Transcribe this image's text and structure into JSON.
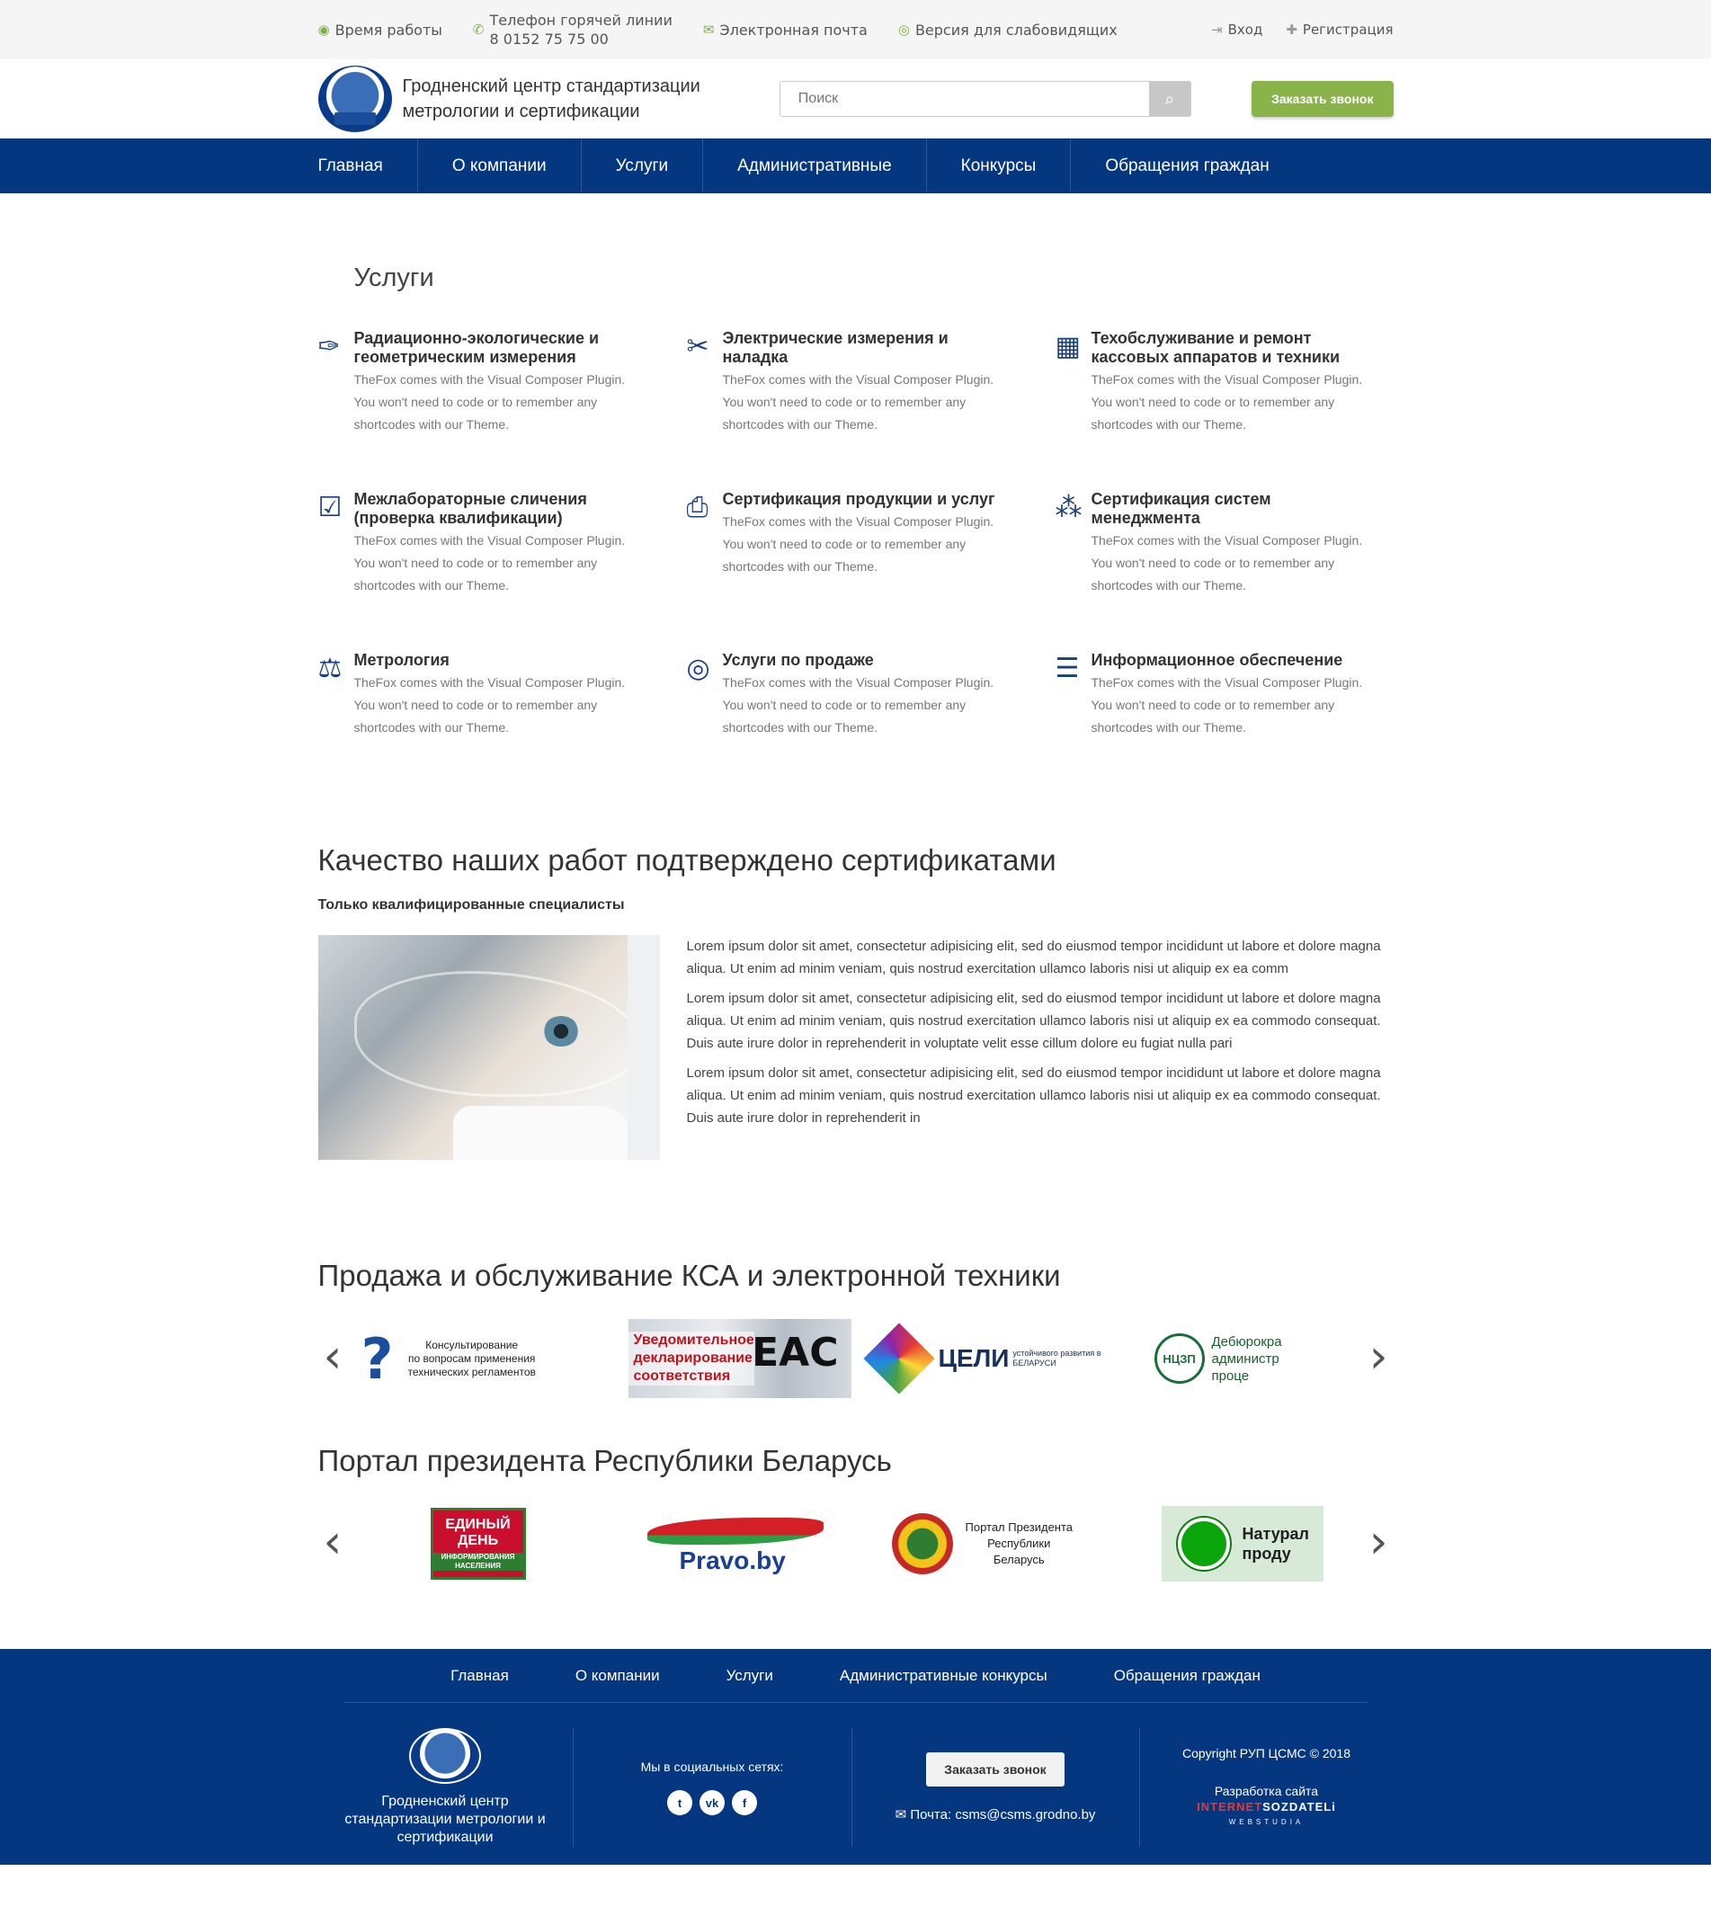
{
  "topbar": {
    "hours": "Время работы",
    "hotline_label": "Телефон горячей линии",
    "hotline_number": "8 0152 75 75 00",
    "email": "Электронная почта",
    "low_vision": "Версия для слабовидящих",
    "login": "Вход",
    "register": "Регистрация"
  },
  "header": {
    "title_line1": "Гродненский центр стандартизации",
    "title_line2": "метрологии и сертификации",
    "search_placeholder": "Поиск",
    "call_button": "Заказать звонок"
  },
  "nav": [
    "Главная",
    "О компании",
    "Услуги",
    "Административные",
    "Конкурсы",
    "Обращения граждан"
  ],
  "services": {
    "title": "Услуги",
    "items": [
      {
        "icon": "compass-icon",
        "glyph": "✑",
        "title": "Радиационно-экологические и геометрическим измерения",
        "text": "TheFox comes with the Visual Composer Plugin. You won't need to code or to remember any shortcodes with our Theme."
      },
      {
        "icon": "tools-icon",
        "glyph": "✂",
        "title": "Электрические измерения и наладка",
        "text": "TheFox comes with the Visual Composer Plugin. You won't need to code or to remember any shortcodes with our Theme."
      },
      {
        "icon": "calculator-icon",
        "glyph": "▦",
        "title": "Техобслуживание и ремонт кассовых аппаратов и техники",
        "text": "TheFox comes with the Visual Composer Plugin. You won't need to code or to remember any shortcodes with our Theme."
      },
      {
        "icon": "clipboard-check-icon",
        "glyph": "☑",
        "title": "Межлабораторные сличения (проверка квалификации)",
        "text": "TheFox comes with the Visual Composer Plugin. You won't need to code or to remember any shortcodes with our Theme."
      },
      {
        "icon": "certificate-icon",
        "glyph": "⎙",
        "title": "Сертификация продукции и услуг",
        "text": "TheFox comes with the Visual Composer Plugin. You won't need to code or to remember any shortcodes with our Theme."
      },
      {
        "icon": "network-icon",
        "glyph": "⁂",
        "title": "Сертификация систем менеджмента",
        "text": "TheFox comes with the Visual Composer Plugin. You won't need to code or to remember any shortcodes with our Theme."
      },
      {
        "icon": "scales-icon",
        "glyph": "⚖",
        "title": "Метрология",
        "text": "TheFox comes with the Visual Composer Plugin. You won't need to code or to remember any shortcodes with our Theme."
      },
      {
        "icon": "coins-icon",
        "glyph": "◎",
        "title": "Услуги по продаже",
        "text": "TheFox comes with the Visual Composer Plugin. You won't need to code or to remember any shortcodes with our Theme."
      },
      {
        "icon": "documents-icon",
        "glyph": "☰",
        "title": "Информационное обеспечение",
        "text": "TheFox comes with the Visual Composer Plugin. You won't need to code or to remember any shortcodes with our Theme."
      }
    ]
  },
  "quality": {
    "title": "Качество наших работ подтверждено сертификатами",
    "subtitle": "Только квалифицированные специалисты",
    "paragraphs": [
      "Lorem ipsum dolor sit amet, consectetur adipisicing elit, sed do eiusmod tempor incididunt ut labore et dolore magna aliqua. Ut enim ad minim veniam, quis nostrud exercitation ullamco laboris nisi ut aliquip ex ea comm",
      "Lorem ipsum dolor sit amet, consectetur adipisicing elit, sed do eiusmod tempor incididunt ut labore et dolore magna aliqua. Ut enim ad minim veniam, quis nostrud exercitation ullamco laboris nisi ut aliquip ex ea commodo consequat. Duis aute irure dolor in reprehenderit in voluptate velit esse cillum dolore eu fugiat nulla pari",
      "Lorem ipsum dolor sit amet, consectetur adipisicing elit, sed do eiusmod tempor incididunt ut labore et dolore magna aliqua. Ut enim ad minim veniam, quis nostrud exercitation ullamco laboris nisi ut aliquip ex ea commodo consequat. Duis aute irure dolor in reprehenderit in"
    ]
  },
  "kca": {
    "title": "Продажа и обслуживание КСА и электронной техники",
    "consult_text_1": "Консультирование",
    "consult_text_2": "по вопросам применения",
    "consult_text_3": "технических регламентов",
    "eac_text_1": "Уведомительное",
    "eac_text_2": "декларирование",
    "eac_text_3": "соответствия",
    "eac_mark": "EAC",
    "celi_text": "ЦЕЛИ",
    "celi_sub_1": "устойчивого развития в",
    "celi_sub_2": "БЕЛАРУСИ",
    "ncz_mark": "НЦЗП",
    "ncz_text_1": "Дебюрокра",
    "ncz_text_2": "администр",
    "ncz_text_3": "проце"
  },
  "portal": {
    "title": "Портал президента Республики Беларусь",
    "eden_1": "ЕДИНЫЙ",
    "eden_2": "ДЕНЬ",
    "eden_3": "ИНФОРМИРОВАНИЯ НАСЕЛЕНИЯ",
    "pravo": "Pravo.by",
    "pres_1": "Портал Президента",
    "pres_2": "Республики",
    "pres_3": "Беларусь",
    "nat_1": "Натурал",
    "nat_2": "проду"
  },
  "footer": {
    "nav": [
      "Главная",
      "О компании",
      "Услуги",
      "Административные конкурсы",
      "Обращения граждан"
    ],
    "title_1": "Гродненский центр",
    "title_2": "стандартизации метрологии и",
    "title_3": "сертификации",
    "social_label": "Мы в социальных сетях:",
    "call_button": "Заказать звонок",
    "mail": "Почта: csms@csms.grodno.by",
    "copyright": "Copyright РУП ЦСМС © 2018",
    "dev_label": "Разработка сайта",
    "dev_brand_1": "INTERNET",
    "dev_brand_2": "SOZDATELi",
    "dev_brand_sub": "WEBSTUDIA"
  }
}
